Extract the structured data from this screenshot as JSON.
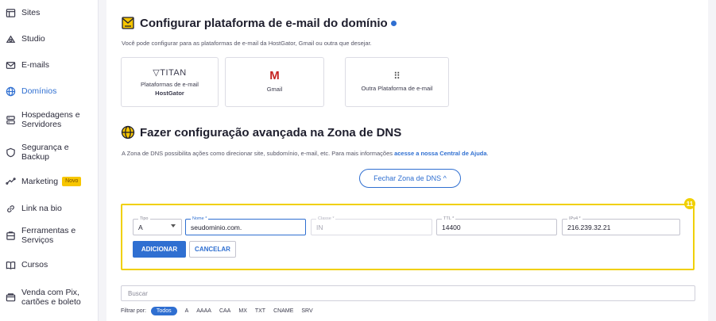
{
  "sidebar": {
    "items": [
      {
        "label": "Sites",
        "icon": "browser-icon"
      },
      {
        "label": "Studio",
        "icon": "studio-icon"
      },
      {
        "label": "E-mails",
        "icon": "mail-icon"
      },
      {
        "label": "Domínios",
        "icon": "globe-icon",
        "active": true
      },
      {
        "label": "Hospedagens e Servidores",
        "icon": "server-icon"
      },
      {
        "label": "Segurança e Backup",
        "icon": "shield-icon"
      },
      {
        "label": "Marketing",
        "icon": "marketing-icon",
        "badge": "Novo"
      },
      {
        "label": "Link na bio",
        "icon": "link-icon"
      },
      {
        "label": "Ferramentas e Serviços",
        "icon": "tools-icon"
      },
      {
        "label": "Cursos",
        "icon": "book-icon"
      },
      {
        "label": "Venda com Pix, cartões e boleto",
        "icon": "payment-icon"
      }
    ]
  },
  "email_section": {
    "title": "Configurar plataforma de e-mail do domínio",
    "description": "Você pode configurar para as plataformas de e-mail da HostGator, Gmail ou outra que desejar.",
    "cards": [
      {
        "brand": "TITAN",
        "line1": "Plataformas de e-mail",
        "line2": "HostGator"
      },
      {
        "brand": "M",
        "line1": "Gmail"
      },
      {
        "brand": "⠿",
        "line1": "Outra Plataforma de e-mail"
      }
    ]
  },
  "dns_section": {
    "title": "Fazer configuração avançada na Zona de DNS",
    "description": "A Zona de DNS possibilita ações como direcionar site, subdomínio, e-mail, etc. Para mais informações",
    "help_link": "acesse a nossa Central de Ajuda",
    "help_suffix": ".",
    "close_button": "Fechar Zona de DNS ^"
  },
  "dns_form": {
    "step_number": "11",
    "tipo": {
      "label": "Tipo",
      "value": "A"
    },
    "nome": {
      "label": "Nome *",
      "value": "seudominio.com."
    },
    "classe": {
      "label": "Classe *",
      "value": "IN"
    },
    "ttl": {
      "label": "TTL *",
      "value": "14400"
    },
    "ipv4": {
      "label": "IPv4 *",
      "value": "216.239.32.21"
    },
    "add_button": "ADICIONAR",
    "cancel_button": "CANCELAR"
  },
  "search": {
    "placeholder": "Buscar"
  },
  "filters": {
    "label": "Filtrar por:",
    "options": [
      "Todos",
      "A",
      "AAAA",
      "CAA",
      "MX",
      "TXT",
      "CNAME",
      "SRV"
    ]
  },
  "colors": {
    "accent": "#2f6fd1",
    "highlight": "#f0d000",
    "badge": "#f7c600"
  }
}
